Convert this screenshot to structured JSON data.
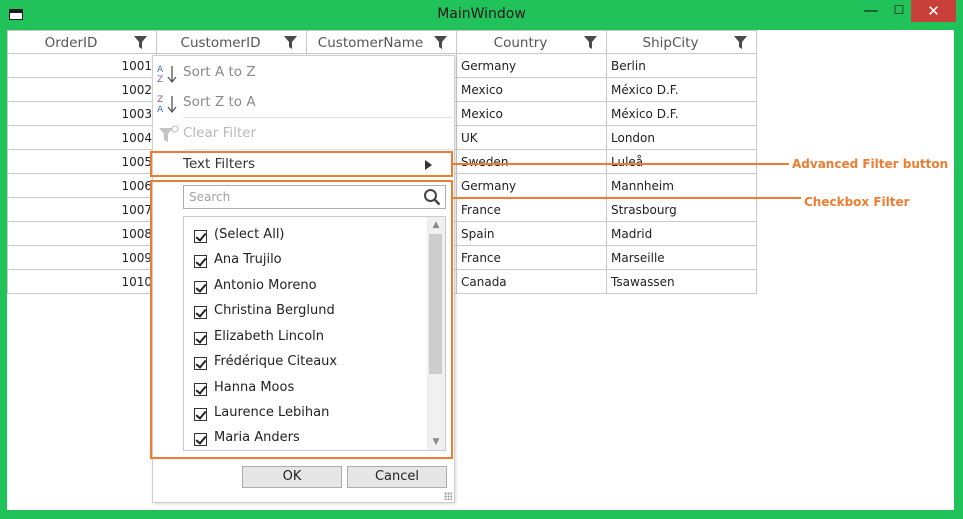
{
  "window": {
    "title": "MainWindow",
    "minimize_glyph": "—",
    "maximize_glyph": "☐",
    "close_glyph": "✕",
    "icon": "app-window-icon"
  },
  "grid": {
    "columns": [
      {
        "label": "OrderID",
        "icon": "filter-icon"
      },
      {
        "label": "CustomerID",
        "icon": "filter-icon"
      },
      {
        "label": "CustomerName",
        "icon": "filter-icon"
      },
      {
        "label": "Country",
        "icon": "filter-icon"
      },
      {
        "label": "ShipCity",
        "icon": "filter-icon"
      }
    ],
    "rows": [
      {
        "order_id": "1001",
        "customer_id": "",
        "customer_name": "",
        "country": "Germany",
        "ship_city": "Berlin"
      },
      {
        "order_id": "1002",
        "customer_id": "",
        "customer_name": "",
        "country": "Mexico",
        "ship_city": "México D.F."
      },
      {
        "order_id": "1003",
        "customer_id": "",
        "customer_name": "",
        "country": "Mexico",
        "ship_city": "México D.F."
      },
      {
        "order_id": "1004",
        "customer_id": "",
        "customer_name": "",
        "country": "UK",
        "ship_city": "London"
      },
      {
        "order_id": "1005",
        "customer_id": "",
        "customer_name": "",
        "country": "Sweden",
        "ship_city": "Luleå"
      },
      {
        "order_id": "1006",
        "customer_id": "",
        "customer_name": "",
        "country": "Germany",
        "ship_city": "Mannheim"
      },
      {
        "order_id": "1007",
        "customer_id": "",
        "customer_name": "",
        "country": "France",
        "ship_city": "Strasbourg"
      },
      {
        "order_id": "1008",
        "customer_id": "",
        "customer_name": "",
        "country": "Spain",
        "ship_city": "Madrid"
      },
      {
        "order_id": "1009",
        "customer_id": "",
        "customer_name": "",
        "country": "France",
        "ship_city": "Marseille"
      },
      {
        "order_id": "1010",
        "customer_id": "",
        "customer_name": "",
        "country": "Canada",
        "ship_city": "Tsawassen"
      }
    ]
  },
  "filter_popup": {
    "sort_asc": "Sort A to Z",
    "sort_desc": "Sort Z to A",
    "clear_filter": "Clear Filter",
    "text_filters": "Text Filters",
    "search_placeholder": "Search",
    "checkbox_items": [
      {
        "label": "(Select All)",
        "checked": true
      },
      {
        "label": "Ana Trujilo",
        "checked": true
      },
      {
        "label": "Antonio Moreno",
        "checked": true
      },
      {
        "label": "Christina Berglund",
        "checked": true
      },
      {
        "label": "Elizabeth Lincoln",
        "checked": true
      },
      {
        "label": "Frédérique Citeaux",
        "checked": true
      },
      {
        "label": "Hanna Moos",
        "checked": true
      },
      {
        "label": "Laurence Lebihan",
        "checked": true
      },
      {
        "label": "Maria Anders",
        "checked": true
      }
    ],
    "ok_label": "OK",
    "cancel_label": "Cancel"
  },
  "callouts": {
    "advanced_filter": "Advanced Filter button",
    "checkbox_filter": "Checkbox Filter"
  },
  "colors": {
    "window_frame": "#22c25a",
    "close_button": "#c7413a",
    "callout": "#ee7d31"
  }
}
